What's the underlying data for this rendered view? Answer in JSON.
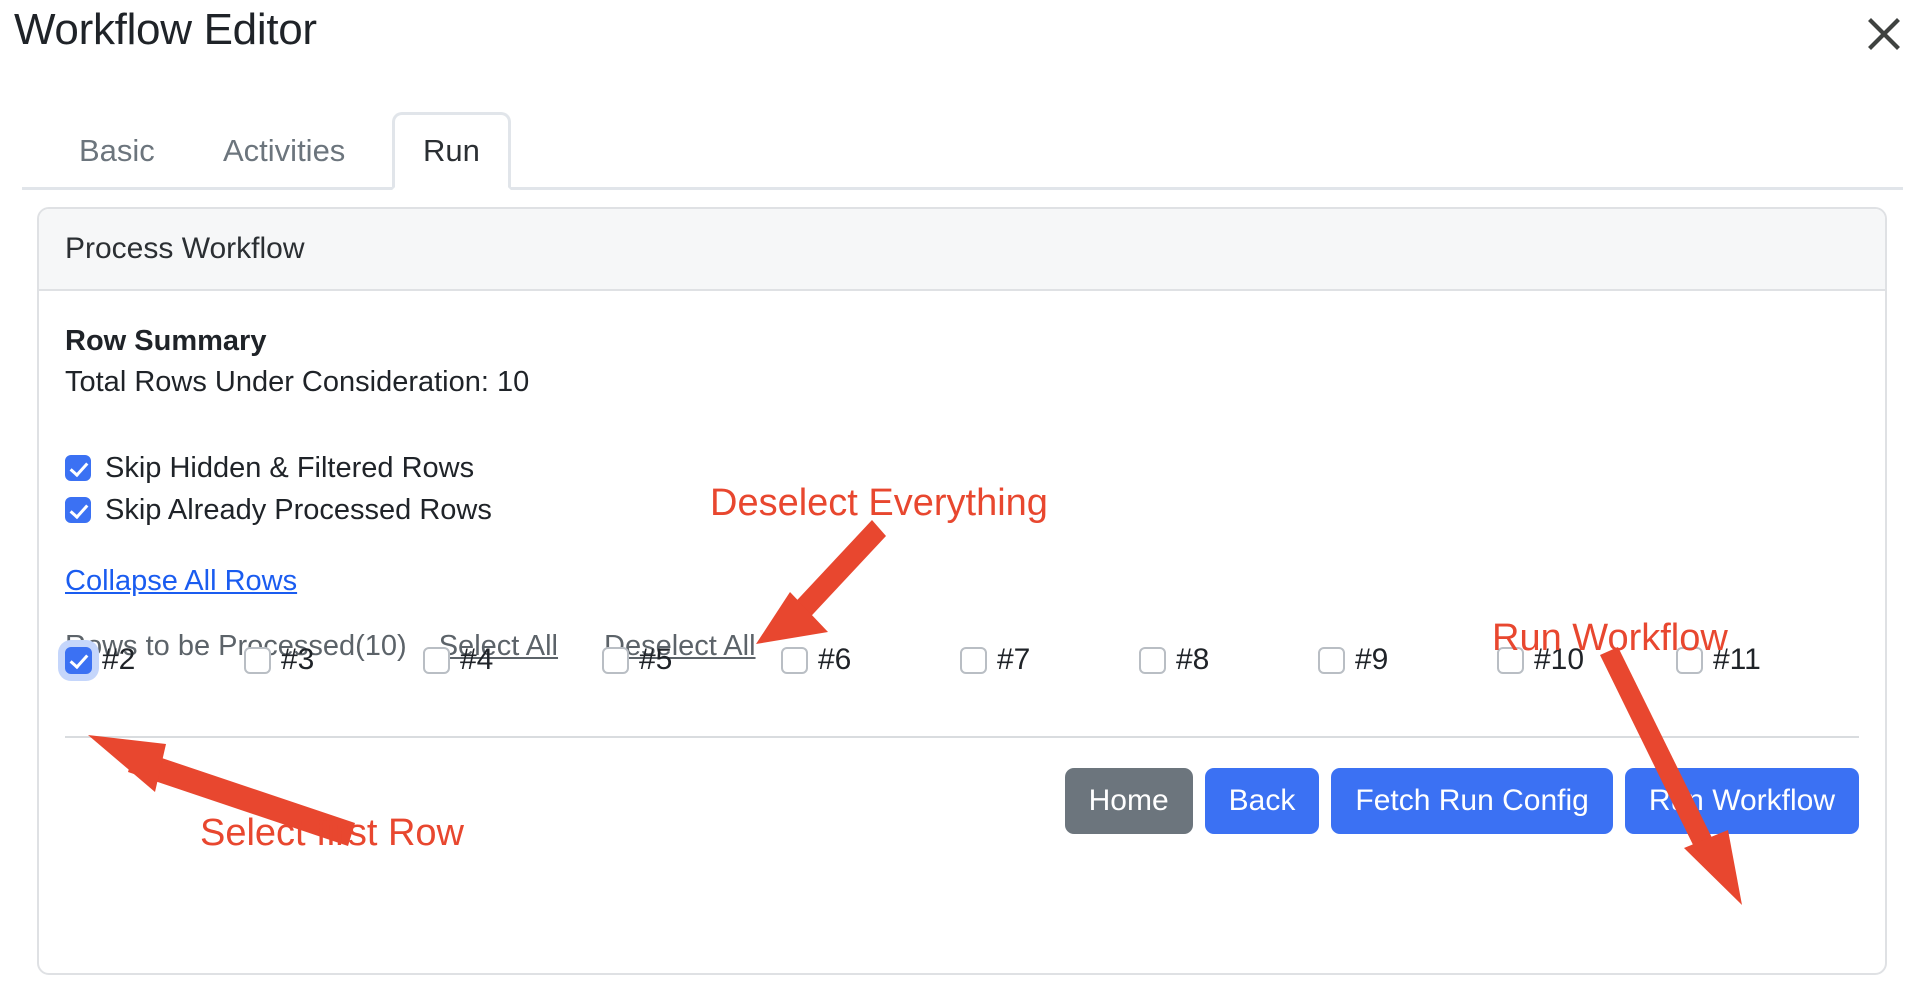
{
  "window": {
    "title": "Workflow Editor",
    "close_icon": "close-icon"
  },
  "tabs": [
    {
      "label": "Basic",
      "active": false
    },
    {
      "label": "Activities",
      "active": false
    },
    {
      "label": "Run",
      "active": true
    }
  ],
  "card": {
    "header": "Process Workflow",
    "row_summary": {
      "title": "Row Summary",
      "total_text": "Total Rows Under Consideration: 10",
      "total_count": 10
    },
    "options": [
      {
        "label": "Skip Hidden & Filtered Rows",
        "checked": true
      },
      {
        "label": "Skip Already Processed Rows",
        "checked": true
      }
    ],
    "collapse_link": "Collapse All Rows",
    "rows_bar": {
      "label": "Rows to be Processed(10)",
      "select_all": "Select All",
      "deselect_all": "Deselect All"
    },
    "rows": [
      {
        "label": "#2",
        "checked": true,
        "focused": true
      },
      {
        "label": "#3",
        "checked": false,
        "focused": false
      },
      {
        "label": "#4",
        "checked": false,
        "focused": false
      },
      {
        "label": "#5",
        "checked": false,
        "focused": false
      },
      {
        "label": "#6",
        "checked": false,
        "focused": false
      },
      {
        "label": "#7",
        "checked": false,
        "focused": false
      },
      {
        "label": "#8",
        "checked": false,
        "focused": false
      },
      {
        "label": "#9",
        "checked": false,
        "focused": false
      },
      {
        "label": "#10",
        "checked": false,
        "focused": false
      },
      {
        "label": "#11",
        "checked": false,
        "focused": false
      }
    ],
    "buttons": [
      {
        "label": "Home",
        "style": "secondary"
      },
      {
        "label": "Back",
        "style": "primary"
      },
      {
        "label": "Fetch Run Config",
        "style": "primary"
      },
      {
        "label": "Run Workflow",
        "style": "primary"
      }
    ]
  },
  "annotations": [
    {
      "text": "Deselect Everything",
      "target": "deselect-all-link"
    },
    {
      "text": "Run Workflow",
      "target": "run-workflow-button"
    },
    {
      "text": "Select first Row",
      "target": "row-checkbox-2"
    }
  ],
  "colors": {
    "accent_blue": "#3b71f3",
    "link_blue": "#1a5cf0",
    "secondary_gray": "#6c757d",
    "annotation_red": "#e8472f",
    "text_dark": "#1f2328",
    "border_gray": "#dfe1e4"
  }
}
